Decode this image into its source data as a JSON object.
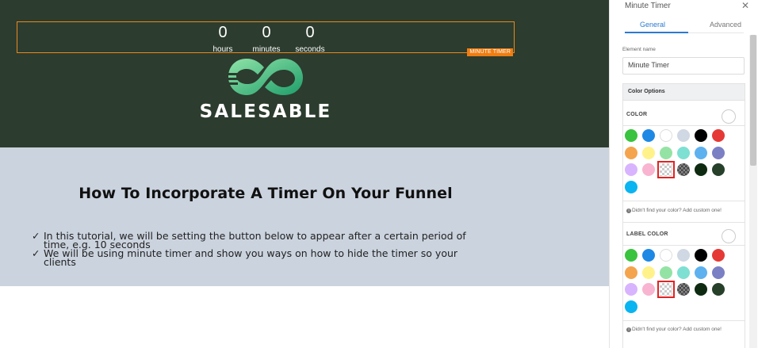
{
  "timer": {
    "tag": "MINUTE TIMER",
    "units": [
      {
        "value": "0",
        "label": "hours"
      },
      {
        "value": "0",
        "label": "minutes"
      },
      {
        "value": "0",
        "label": "seconds"
      }
    ]
  },
  "logo": {
    "text": "SALESABLE"
  },
  "content": {
    "heading": "How To Incorporate A Timer On Your Funnel",
    "bullets": [
      {
        "check": "✓",
        "text": "In this tutorial, we will be setting the button below to appear after a certain period of time, e.g. 10 seconds"
      },
      {
        "check": "✓",
        "text": "We will be using minute timer and show you ways on how to hide the timer so your clients"
      }
    ]
  },
  "panel": {
    "title": "Minute Timer",
    "close": "✕",
    "tabs": [
      "General",
      "Advanced"
    ],
    "element_name_label": "Element name",
    "element_name_value": "Minute Timer",
    "section_title": "Color Options",
    "groups": [
      {
        "label": "COLOR",
        "hint": "Didn't find your color? Add custom one!"
      },
      {
        "label": "LABEL COLOR",
        "hint": "Didn't find your color? Add custom one!"
      }
    ],
    "palette": [
      "#3ac33e",
      "#1e88e5",
      "#ffffff",
      "#cfd8e3",
      "#000000",
      "#e53935",
      "#f4a44c",
      "#fff28a",
      "#94e3a5",
      "#7de0d2",
      "#5eb1ef",
      "#7b7fc4",
      "#d8b4fe",
      "#f8b4d0",
      "checker-light",
      "checker-dark",
      "#0e2b12",
      "#26402a",
      "#0ab4f0"
    ],
    "selected_index": 14
  },
  "colors": {
    "hero_bg": "#2c3c2e",
    "band_bg": "#cbd3de",
    "accent": "#2a7ad1",
    "timer_border": "#e8891f"
  }
}
